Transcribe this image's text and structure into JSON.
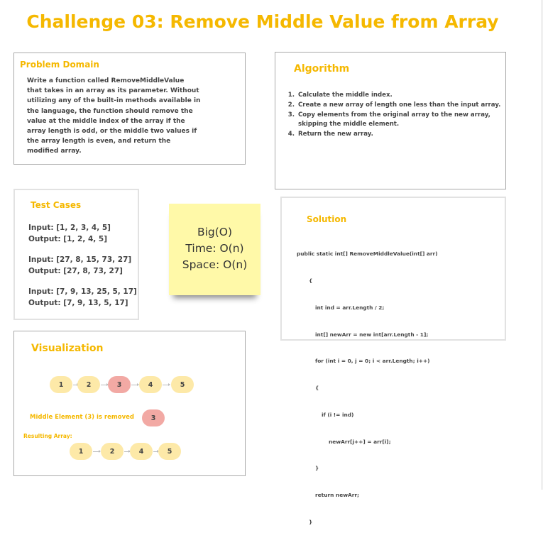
{
  "title": "Challenge 03: Remove Middle Value from Array",
  "problem": {
    "heading": "Problem Domain",
    "lines": [
      "Write a function called RemoveMiddleValue",
      "that takes in an array as its parameter. Without",
      "utilizing any of the built-in methods available in",
      "the language, the function should remove the",
      "value at the middle index of the array if the",
      "array length is odd, or the middle two values if",
      "the array length is even, and return the",
      "modified array."
    ]
  },
  "algorithm": {
    "heading": "Algorithm",
    "steps": [
      "Calculate the middle index.",
      "Create a new array of length one less than the input array.",
      "Copy elements from the original array to the new array, skipping the middle element.",
      "Return the new array."
    ]
  },
  "tests": {
    "heading": "Test Cases",
    "cases": [
      {
        "input": "Input: [1, 2, 3, 4, 5]",
        "output": "Output: [1, 2, 4, 5]"
      },
      {
        "input": "Input: [27, 8, 15, 73, 27]",
        "output": "Output: [27, 8, 73, 27]"
      },
      {
        "input": "Input: [7, 9, 13, 25, 5, 17]",
        "output": "Output: [7, 9, 13, 5, 17]"
      }
    ]
  },
  "complexity": {
    "title": "Big(O)",
    "time": "Time: O(n)",
    "space": "Space: O(n)"
  },
  "solution": {
    "heading": "Solution",
    "code": [
      "public static int[] RemoveMiddleValue(int[] arr)",
      "{",
      "int ind = arr.Length / 2;",
      "int[] newArr = new int[arr.Length - 1];",
      "for (int i = 0, j = 0; i < arr.Length; i++)",
      "{",
      "if (i != ind)",
      "newArr[j++] = arr[i];",
      "}",
      "return newArr;",
      "}"
    ]
  },
  "visualization": {
    "heading": "Visualization",
    "original": [
      "1",
      "2",
      "3",
      "4",
      "5"
    ],
    "removed_label": "Middle Element (3) is removed",
    "removed_value": "3",
    "result_label": "Resulting Array:",
    "result": [
      "1",
      "2",
      "4",
      "5"
    ],
    "colors": {
      "node": "#fde9a8",
      "highlight": "#f2a9a4",
      "accent": "#f5b800"
    }
  }
}
